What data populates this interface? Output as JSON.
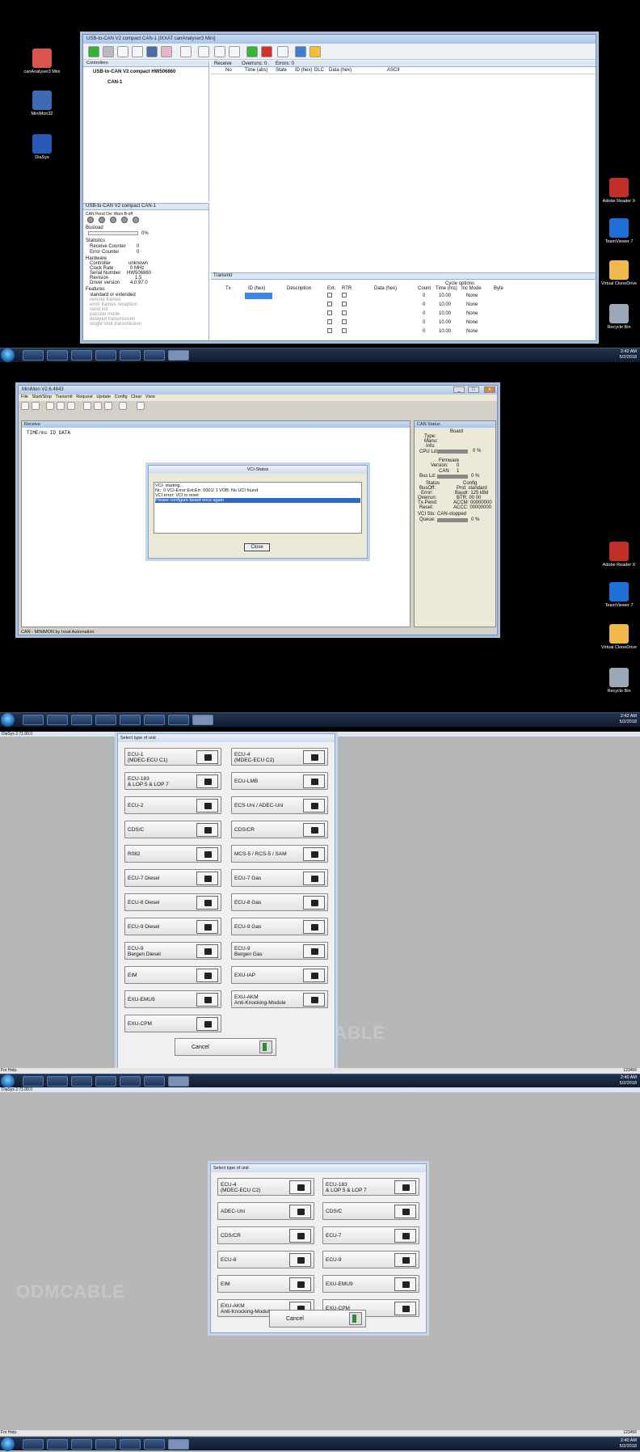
{
  "section1": {
    "desktop_icons": [
      {
        "label": "canAnalyser3 Mini",
        "color": "#d9534f"
      },
      {
        "label": "MiniMon32",
        "color": "#3d6bb3"
      },
      {
        "label": "DiaSys",
        "color": "#2a5ab8"
      }
    ],
    "right_icons": [
      {
        "label": "Adobe Reader X",
        "color": "#c0302b"
      },
      {
        "label": "TeamViewer 7",
        "color": "#1f6fd6"
      },
      {
        "label": "Virtual CloneDrive",
        "color": "#f0b84a"
      },
      {
        "label": "Recycle Bin",
        "color": "#9aa8b8"
      }
    ],
    "window_title": "USB-to-CAN V2 compact  CAN-1 [IXXAT canAnalyser3 Mini]",
    "controllers_header": "Controllers",
    "controller_name": "USB-to-CAN V2 compact  HW506860",
    "can_node": "CAN-1",
    "receive_header": "Receive",
    "overruns": "Overruns: 0",
    "errors": "Errors: 0",
    "recv_cols": [
      "No",
      "Time (abs)",
      "State",
      "ID (hex)",
      "DLC",
      "Data (hex)",
      "ASCII"
    ],
    "status_panel_title": "USB-to-CAN V2 compact  CAN-1",
    "leds": [
      "CAN",
      "Pend",
      "Ovr",
      "Warn",
      "B-off"
    ],
    "busload_label": "Busload",
    "busload_value": "0%",
    "statistics_label": "Statistics",
    "stats": [
      [
        "Receive Counter",
        "0"
      ],
      [
        "Error Counter",
        "0"
      ]
    ],
    "hardware_label": "Hardware",
    "hardware": [
      [
        "Controller",
        "unknown"
      ],
      [
        "Clock Rate",
        "0 MHz"
      ],
      [
        "Serial Number",
        "HW506860"
      ],
      [
        "Revision",
        "1.5"
      ],
      [
        "Driver version",
        "4.0.97.0"
      ]
    ],
    "features_label": "Features",
    "features": [
      "standard  or  extended",
      "remote frames",
      "error frames reception",
      "send init",
      "passive mode",
      "delayed transmission",
      "single shot transmission"
    ],
    "transmit_header": "Transmit",
    "tx_cols": [
      "Tx",
      "ID (hex)",
      "Description",
      "Ext.",
      "RTR",
      "Data (hex)"
    ],
    "cycle_options": "Cycle options",
    "cycle_cols": [
      "Count",
      "Time (ms)",
      "Inc Mode",
      "Byte"
    ],
    "tx_rows": [
      [
        "0",
        "10.00",
        "None"
      ],
      [
        "0",
        "10.00",
        "None"
      ],
      [
        "0",
        "10.00",
        "None"
      ],
      [
        "0",
        "10.00",
        "None"
      ],
      [
        "0",
        "10.00",
        "None"
      ]
    ],
    "clock_time": "2:42 AM",
    "clock_date": "5/2/2018"
  },
  "section2": {
    "window_title": "MiniMon V2.6.4843",
    "menu": [
      "File",
      "Start/Stop",
      "Transmit",
      "Request",
      "Update",
      "Config",
      "Clear",
      "View"
    ],
    "receive_title": "Receive",
    "receive_header": "TIME/ms    ID   DATA",
    "dialog_title": "VCI-Status",
    "dialog_lines": [
      "VCI- starting...",
      "Nr.: 0 VCI-Error:Ext.Err: 0001/   1 VOB: No UCI found",
      "VCI error: VCI is reset",
      "Please configure board once again"
    ],
    "close_label": "Close",
    "status_bar": "CAN - MINIMON  by  Ixxat Automation",
    "can_status_title": "CAN Status",
    "board_label": "Board",
    "type_label": "Type:",
    "manu_label": "Manu:",
    "info_label": "Info:",
    "cpu_label": "CPU Ld:",
    "cpu_value": "0 %",
    "firmware_label": "Firmware",
    "version_label": "Version:",
    "version_value": "0",
    "can_label": "CAN",
    "can_value": "1",
    "bus_label": "Bus Ld:",
    "bus_value": "0 %",
    "status_label": "Status",
    "config_label": "Config",
    "status_items": [
      "BusOff:",
      "Error:",
      "Overrun:",
      "Tx-Pend:",
      "Reset:"
    ],
    "config_items": [
      "Prot:  standard",
      "Baudr:   125 kBd",
      "BTR:  00  00",
      "ACCM:  00000000",
      "ACCC:  00000000"
    ],
    "vci_sts_label": "VCI Sts:",
    "vci_sts_value": "CAN-stopped",
    "queue_label": "Queue:",
    "queue_value": "0 %",
    "clock_time": "2:42 AM",
    "clock_date": "5/2/2018"
  },
  "section3": {
    "app_title": "DiaSys 2.71.00.0",
    "dialog_title": "Select type of unit",
    "units": [
      [
        "ECU-1\n(MDEC-ECU C1)",
        "ECU-4\n(MDEC-ECU C2)"
      ],
      [
        "ECU-183\n& LOP 5 & LOP 7",
        "ECU-LMB"
      ],
      [
        "ECU-2",
        "ECS-Uni / ADEC-Uni"
      ],
      [
        "CDS/C",
        "CDS/CR"
      ],
      [
        "R082",
        "MCS-5 / RCS-5 / SAM"
      ],
      [
        "ECU-7 Diesel",
        "ECU-7 Gas"
      ],
      [
        "ECU-8 Diesel",
        "ECU-8 Gas"
      ],
      [
        "ECU-9 Diesel",
        "ECU-9 Gas"
      ],
      [
        "ECU-9\nBergen Diesel",
        "ECU-9\nBergen Gas"
      ],
      [
        "EIM",
        "EXU-IAP"
      ],
      [
        "EXU-EMU9",
        "EXU-AKM\nAnti-Knocking-Module"
      ],
      [
        "EXU-CPM",
        ""
      ]
    ],
    "cancel_label": "Cancel",
    "status_help": "For Help.",
    "status_code": "123456",
    "clock_time": "2:40 AM",
    "clock_date": "5/2/2018"
  },
  "section4": {
    "app_title": "DiaSys 2.71.00.0",
    "dialog_title": "Select type of unit",
    "units": [
      [
        "ECU-4\n(MDEC-ECU C2)",
        "ECU-183\n& LOP 5 & LOP 7"
      ],
      [
        "ADEC-Uni",
        "CDS/C"
      ],
      [
        "CDS/CR",
        "ECU-7"
      ],
      [
        "ECU-8",
        "ECU-9"
      ],
      [
        "EIM",
        "EXU-EMU9"
      ],
      [
        "EXU-AKM\nAnti-Knocking-Module",
        "EXU-CPM"
      ]
    ],
    "cancel_label": "Cancel",
    "status_help": "For Help.",
    "status_code": "123456",
    "clock_time": "2:40 AM",
    "clock_date": "5/2/2018"
  },
  "watermark": "ODMCABLE"
}
